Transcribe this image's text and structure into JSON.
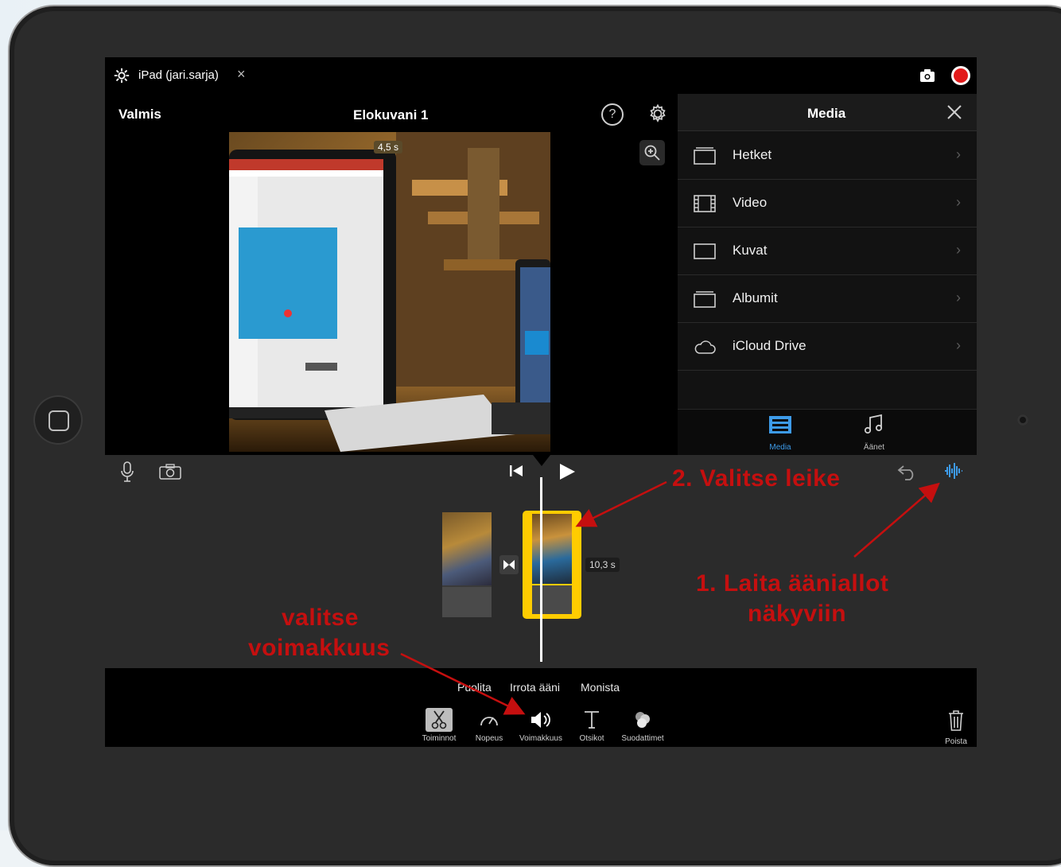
{
  "topbar": {
    "device": "iPad (jari.sarja)",
    "close": "×"
  },
  "editor": {
    "done_label": "Valmis",
    "title": "Elokuvani 1",
    "help": "?",
    "preview_duration": "4,5 s"
  },
  "media": {
    "title": "Media",
    "items": [
      {
        "label": "Hetket",
        "icon": "moments-icon"
      },
      {
        "label": "Video",
        "icon": "film-icon"
      },
      {
        "label": "Kuvat",
        "icon": "photos-icon"
      },
      {
        "label": "Albumit",
        "icon": "albums-icon"
      },
      {
        "label": "iCloud Drive",
        "icon": "cloud-icon"
      }
    ],
    "tabs": [
      {
        "label": "Media",
        "active": true
      },
      {
        "label": "Äänet",
        "active": false
      }
    ]
  },
  "timeline": {
    "clip_duration": "10,3 s"
  },
  "actions": [
    "Puolita",
    "Irrota ääni",
    "Monista"
  ],
  "tools": [
    {
      "label": "Toiminnot",
      "icon": "scissors-icon",
      "selected": true
    },
    {
      "label": "Nopeus",
      "icon": "speed-icon",
      "selected": false
    },
    {
      "label": "Voimakkuus",
      "icon": "volume-icon",
      "selected": false
    },
    {
      "label": "Otsikot",
      "icon": "titles-icon",
      "selected": false
    },
    {
      "label": "Suodattimet",
      "icon": "filters-icon",
      "selected": false
    }
  ],
  "delete_label": "Poista",
  "annotations": {
    "step2": "2. Valitse leike",
    "step1_line1": "1. Laita ääniallot",
    "step1_line2": "näkyviin",
    "vol_line1": "valitse",
    "vol_line2": "voimakkuus"
  },
  "colors": {
    "accent": "#3d9be9",
    "annotation": "#c50f0f",
    "selection": "#ffcc00",
    "record": "#e21b1b"
  }
}
